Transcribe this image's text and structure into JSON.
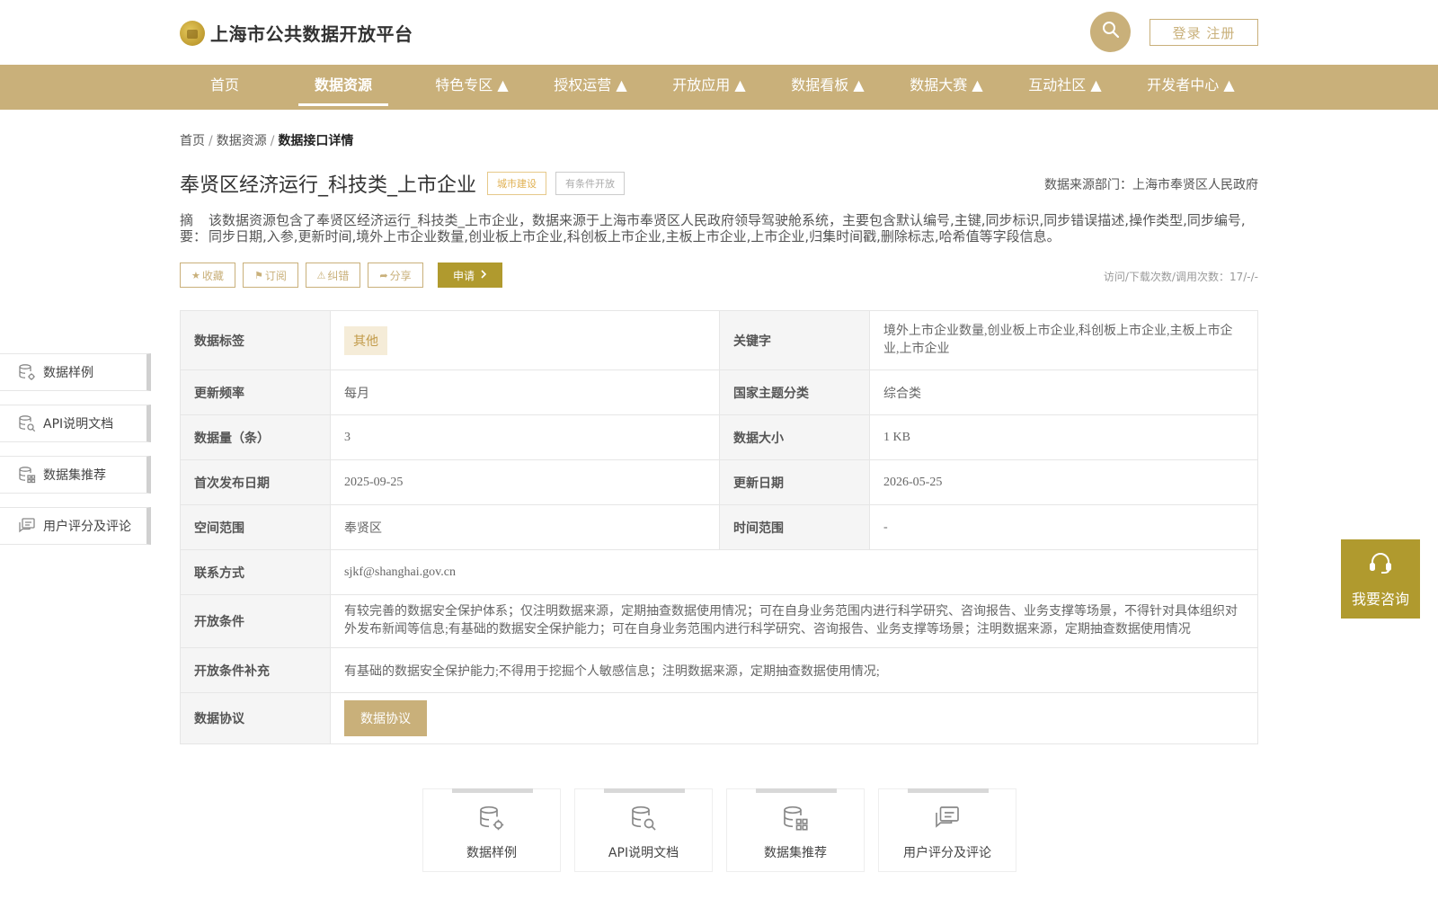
{
  "header": {
    "logo_text": "上海市公共数据开放平台",
    "login_label": "登录 注册"
  },
  "nav": {
    "items": [
      {
        "label": "首页"
      },
      {
        "label": "数据资源",
        "active": true
      },
      {
        "label": "特色专区 ▲"
      },
      {
        "label": "授权运营 ▲"
      },
      {
        "label": "开放应用 ▲"
      },
      {
        "label": "数据看板 ▲"
      },
      {
        "label": "数据大赛 ▲"
      },
      {
        "label": "互动社区 ▲"
      },
      {
        "label": "开发者中心 ▲"
      }
    ]
  },
  "breadcrumb": {
    "home": "首页",
    "sep": "/",
    "section": "数据资源",
    "current": "数据接口详情"
  },
  "dataset": {
    "title": "奉贤区经济运行_科技类_上市企业",
    "tag_city": "城市建设",
    "tag_condition": "有条件开放",
    "source_dept": "数据来源部门：上海市奉贤区人民政府",
    "abstract_label": "摘　要：",
    "abstract_text": "该数据资源包含了奉贤区经济运行_科技类_上市企业，数据来源于上海市奉贤区人民政府领导驾驶舱系统，主要包含默认编号,主键,同步标识,同步错误描述,操作类型,同步编号,同步日期,入参,更新时间,境外上市企业数量,创业板上市企业,科创板上市企业,主板上市企业,上市企业,归集时间戳,删除标志,哈希值等字段信息。",
    "visit_count": "访问/下载次数/调用次数：17/-/-"
  },
  "actions": {
    "favorite": "收藏",
    "subscribe": "订阅",
    "correct": "纠错",
    "share": "分享",
    "apply": "申请"
  },
  "info": {
    "tag_label": "数据标签",
    "tag_value": "其他",
    "keyword_label": "关键字",
    "keyword_value": "境外上市企业数量,创业板上市企业,科创板上市企业,主板上市企业,上市企业",
    "freq_label": "更新频率",
    "freq_value": "每月",
    "theme_label": "国家主题分类",
    "theme_value": "综合类",
    "count_label": "数据量（条）",
    "count_value": "3",
    "size_label": "数据大小",
    "size_value": "1 KB",
    "first_pub_label": "首次发布日期",
    "first_pub_value": "2025-09-25",
    "update_label": "更新日期",
    "update_value": "2026-05-25",
    "space_label": "空间范围",
    "space_value": "奉贤区",
    "time_label": "时间范围",
    "time_value": "-",
    "contact_label": "联系方式",
    "contact_value": "sjkf@shanghai.gov.cn",
    "open_cond_label": "开放条件",
    "open_cond_value": "有较完善的数据安全保护体系；仅注明数据来源，定期抽查数据使用情况；可在自身业务范围内进行科学研究、咨询报告、业务支撑等场景，不得针对具体组织对外发布新闻等信息;有基础的数据安全保护能力；可在自身业务范围内进行科学研究、咨询报告、业务支撑等场景；注明数据来源，定期抽查数据使用情况",
    "open_cond_extra_label": "开放条件补充",
    "open_cond_extra_value": "有基础的数据安全保护能力;不得用于挖掘个人敏感信息；注明数据来源，定期抽查数据使用情况;",
    "protocol_label": "数据协议",
    "protocol_button": "数据协议"
  },
  "side_menu": [
    {
      "label": "数据样例",
      "icon": "database-gear-icon"
    },
    {
      "label": "API说明文档",
      "icon": "database-search-icon"
    },
    {
      "label": "数据集推荐",
      "icon": "database-grid-icon"
    },
    {
      "label": "用户评分及评论",
      "icon": "comment-icon"
    }
  ],
  "consult": {
    "label": "我要咨询"
  },
  "bottom_cards": [
    {
      "label": "数据样例",
      "icon": "database-gear-icon"
    },
    {
      "label": "API说明文档",
      "icon": "database-search-icon"
    },
    {
      "label": "数据集推荐",
      "icon": "database-grid-icon"
    },
    {
      "label": "用户评分及评论",
      "icon": "comment-icon"
    }
  ],
  "colors": {
    "brand": "#c9b07a",
    "accent_dark": "#b09a2e",
    "tag_bg": "#f5ecd8",
    "label_bg": "#f5f5f5"
  }
}
